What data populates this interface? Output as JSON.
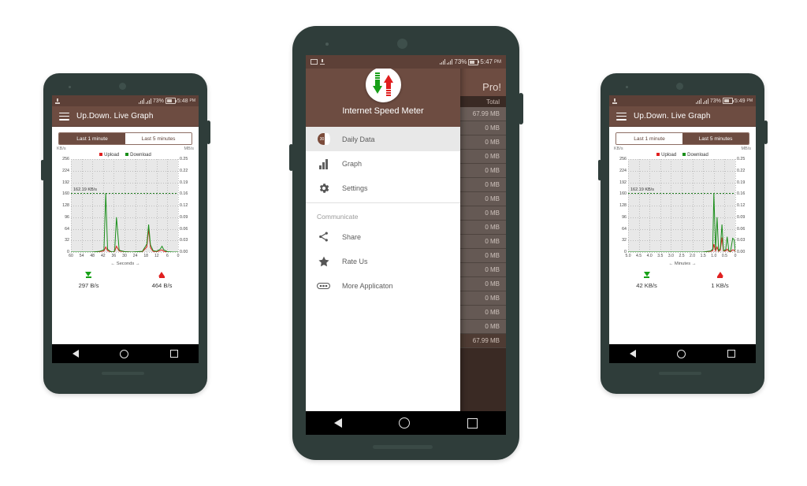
{
  "app": {
    "name": "Internet Speed Meter",
    "title": "Up.Down. Live Graph"
  },
  "left_phone": {
    "status": {
      "battery": "73%",
      "time": "5:48",
      "ampm": "PM"
    },
    "appbar_title": "Up.Down. Live Graph",
    "tabs": [
      {
        "label": "Last 1 minute",
        "selected": true
      },
      {
        "label": "Last 5 minutes",
        "selected": false
      }
    ],
    "left_unit": "KB/s",
    "right_unit": "MB/s",
    "legend": [
      {
        "label": "Upload",
        "color": "#e02020"
      },
      {
        "label": "Download",
        "color": "#1b8f1b"
      }
    ],
    "peak_label": "162.19 KB/s",
    "download_total": "297 B/s",
    "upload_total": "464 B/s"
  },
  "center_phone": {
    "status": {
      "battery": "73%",
      "time": "5:47",
      "ampm": "PM"
    },
    "background": {
      "title_fragment": "Pro!",
      "column_header": "Total",
      "rows": [
        "67.99 MB",
        "0 MB",
        "0 MB",
        "0 MB",
        "0 MB",
        "0 MB",
        "0 MB",
        "0 MB",
        "0 MB",
        "0 MB",
        "0 MB",
        "0 MB",
        "0 MB",
        "0 MB",
        "0 MB",
        "0 MB"
      ],
      "footer_total": "67.99 MB"
    },
    "drawer": {
      "header_title": "Internet Speed Meter",
      "logo_badge": "30",
      "items": [
        {
          "label": "Daily Data",
          "icon": "daily-data-icon",
          "selected": true
        },
        {
          "label": "Graph",
          "icon": "bar-chart-icon",
          "selected": false
        },
        {
          "label": "Settings",
          "icon": "gear-icon",
          "selected": false
        }
      ],
      "section_label": "Communicate",
      "communicate_items": [
        {
          "label": "Share",
          "icon": "share-icon"
        },
        {
          "label": "Rate Us",
          "icon": "star-icon"
        },
        {
          "label": "More Applicaton",
          "icon": "more-apps-icon"
        }
      ]
    }
  },
  "right_phone": {
    "status": {
      "battery": "73%",
      "time": "5:49",
      "ampm": "PM"
    },
    "appbar_title": "Up.Down. Live Graph",
    "tabs": [
      {
        "label": "Last 1 minute",
        "selected": false
      },
      {
        "label": "Last 5 minutes",
        "selected": true
      }
    ],
    "left_unit": "KB/s",
    "right_unit": "MB/s",
    "legend": [
      {
        "label": "Upload",
        "color": "#e02020"
      },
      {
        "label": "Download",
        "color": "#1b8f1b"
      }
    ],
    "peak_label": "162.19 KB/s",
    "download_total": "42 KB/s",
    "upload_total": "1 KB/s"
  },
  "chart_data": [
    {
      "id": "left-chart-1-minute",
      "type": "line",
      "title": "",
      "xlabel": "← Seconds →",
      "ylabel": "KB/s",
      "y2label": "MB/s",
      "ylim": [
        0,
        256
      ],
      "y_ticks": [
        256,
        224,
        192,
        160,
        128,
        96,
        64,
        32,
        0
      ],
      "y2_ticks": [
        "0.25",
        "0.22",
        "0.19",
        "0.16",
        "0.12",
        "0.09",
        "0.06",
        "0.03",
        "0.00"
      ],
      "xlim": [
        60,
        0
      ],
      "x_ticks": [
        60,
        54,
        48,
        42,
        36,
        30,
        24,
        18,
        12,
        6,
        0
      ],
      "grid": true,
      "legend_position": "top-center",
      "annotation": {
        "text": "162.19 KB/s",
        "y": 162.19
      },
      "series": [
        {
          "name": "Download",
          "color": "#1b8f1b",
          "x": [
            60,
            54,
            48,
            44,
            41.5,
            40.5,
            39.5,
            38,
            36.5,
            35.5,
            34.5,
            33,
            30,
            26,
            20,
            17.5,
            16.5,
            15.5,
            14,
            12,
            10,
            9,
            8,
            6,
            3,
            0
          ],
          "values": [
            0,
            0,
            0,
            2,
            6,
            162,
            8,
            2,
            0,
            4,
            96,
            5,
            1,
            0,
            2,
            22,
            76,
            20,
            4,
            2,
            8,
            16,
            6,
            1,
            0,
            0
          ]
        },
        {
          "name": "Upload",
          "color": "#e02020",
          "x": [
            60,
            54,
            48,
            44,
            41.5,
            40.5,
            39.5,
            38,
            36.5,
            35.5,
            34.5,
            33,
            30,
            26,
            20,
            17.5,
            16.5,
            15.5,
            14,
            12,
            10,
            9,
            8,
            6,
            3,
            0
          ],
          "values": [
            0,
            0,
            0,
            1,
            3,
            14,
            4,
            1,
            0,
            2,
            16,
            3,
            1,
            0,
            1,
            14,
            64,
            12,
            2,
            1,
            4,
            6,
            2,
            0,
            0,
            0
          ]
        }
      ]
    },
    {
      "id": "right-chart-5-minutes",
      "type": "line",
      "title": "",
      "xlabel": "← Minutes →",
      "ylabel": "KB/s",
      "y2label": "MB/s",
      "ylim": [
        0,
        256
      ],
      "y_ticks": [
        256,
        224,
        192,
        160,
        128,
        96,
        64,
        32,
        0
      ],
      "y2_ticks": [
        "0.25",
        "0.22",
        "0.19",
        "0.16",
        "0.12",
        "0.09",
        "0.06",
        "0.03",
        "0.00"
      ],
      "xlim": [
        5.0,
        0
      ],
      "x_ticks": [
        "5.0",
        "4.5",
        "4.0",
        "3.5",
        "3.0",
        "2.5",
        "2.0",
        "1.5",
        "1.0",
        "0.5",
        "0"
      ],
      "grid": true,
      "legend_position": "top-center",
      "annotation": {
        "text": "162.19 KB/s",
        "y": 162.19
      },
      "series": [
        {
          "name": "Download",
          "color": "#1b8f1b",
          "x": [
            5.0,
            4.5,
            4.0,
            3.5,
            3.0,
            2.5,
            2.0,
            1.5,
            1.15,
            1.05,
            1.0,
            0.92,
            0.85,
            0.78,
            0.7,
            0.62,
            0.55,
            0.45,
            0.38,
            0.3,
            0.22,
            0.12,
            0.05,
            0.0
          ],
          "values": [
            0,
            0,
            0,
            0,
            0,
            0,
            0,
            0,
            3,
            8,
            162,
            6,
            96,
            4,
            10,
            76,
            4,
            6,
            42,
            4,
            2,
            38,
            34,
            2
          ]
        },
        {
          "name": "Upload",
          "color": "#e02020",
          "x": [
            5.0,
            4.5,
            4.0,
            3.5,
            3.0,
            2.5,
            2.0,
            1.5,
            1.15,
            1.05,
            1.0,
            0.92,
            0.85,
            0.78,
            0.7,
            0.62,
            0.55,
            0.45,
            0.38,
            0.3,
            0.22,
            0.12,
            0.05,
            0.0
          ],
          "values": [
            0,
            0,
            0,
            0,
            0,
            0,
            0,
            0,
            2,
            4,
            22,
            3,
            14,
            2,
            5,
            40,
            3,
            3,
            8,
            2,
            1,
            6,
            5,
            1
          ]
        }
      ]
    }
  ]
}
